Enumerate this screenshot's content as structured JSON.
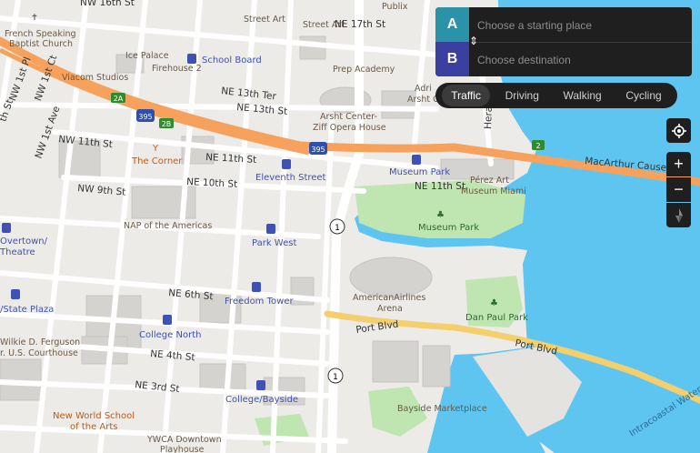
{
  "directions": {
    "start_badge": "A",
    "end_badge": "B",
    "start_placeholder": "Choose a starting place",
    "end_placeholder": "Choose destination",
    "start_color": "#2a93a8",
    "end_color": "#3b3fa0"
  },
  "modes": [
    {
      "label": "Traffic",
      "active": true
    },
    {
      "label": "Driving",
      "active": false
    },
    {
      "label": "Walking",
      "active": false
    },
    {
      "label": "Cycling",
      "active": false
    }
  ],
  "controls": {
    "locate_icon": "crosshair-icon",
    "zoom_in": "+",
    "zoom_out": "−",
    "compass_icon": "compass-icon"
  },
  "colors": {
    "water": "#5ec5f0",
    "park": "#bfe5b0",
    "highway": "#f6a15c",
    "arterial": "#f4cf6e",
    "land": "#ecebe8"
  },
  "map": {
    "streets": {
      "nw16": "NW 16th St",
      "ne17": "NE 17th St",
      "nw1pl": "NW 1st Pl",
      "nw1ct": "NW 1st Ct",
      "ne13ter": "NE 13th Ter",
      "ne13": "NE 13th St",
      "nw11": "NW 11th St",
      "ne11": "NE 11th St",
      "ne11b": "NE 11th St",
      "ne10": "NE 10th St",
      "nw9": "NW 9th St",
      "nw1ave": "NW 1st Ave",
      "ne6": "NE 6th St",
      "ne4": "NE 4th St",
      "ne3": "NE 3rd St",
      "portblvd1": "Port Blvd",
      "portblvd2": "Port Blvd",
      "macarthur": "MacArthur Causew",
      "herald": "Herald",
      "th": "th St",
      "th2": "th St"
    },
    "shields": {
      "i395a": "395",
      "i395b": "395",
      "us1a": "1",
      "us1b": "1",
      "r2a": "2A",
      "r2b": "2B",
      "r2": "2"
    },
    "pois": {
      "french": "French Speaking",
      "french2": "Baptist Church",
      "iceplace": "Ice Palace",
      "firehouse": "Firehouse 2",
      "viacom": "Viacom Studios",
      "streetart1": "Street Art",
      "streetart2": "Street Art",
      "publix": "Publix",
      "prep": "Prep Academy",
      "adri": "Adri",
      "arsht": "Arsht C",
      "arshtcenter": "Arsht Center-",
      "ziff": "Ziff Opera House",
      "corner": "The Corner",
      "nap": "NAP of the Americas",
      "perez1": "Pérez Art",
      "perez2": "Museum Miami",
      "arena1": "AmericanAirlines",
      "arena2": "Arena",
      "bayside": "Bayside Marketplace",
      "newworld1": "New World School",
      "newworld2": "of the Arts",
      "ywca1": "YWCA Downtown",
      "ywca2": "Playhouse",
      "wilkie1": "Wilkie D. Ferguson",
      "wilkie2": "r. U.S. Courthouse"
    },
    "transit": {
      "school": "School Board",
      "museum": "Museum Park",
      "eleventh": "Eleventh Street",
      "parkwest": "Park West",
      "freedom": "Freedom Tower",
      "college_n": "College North",
      "college_b": "College/Bayside",
      "overtown1": "Overtown/",
      "overtown2": "Theatre",
      "state": "/State Plaza"
    },
    "parks": {
      "museum_park": "Museum Park",
      "danpaul": "Dan Paul Park"
    },
    "water": {
      "icw": "Intracoastal Waterway"
    }
  }
}
